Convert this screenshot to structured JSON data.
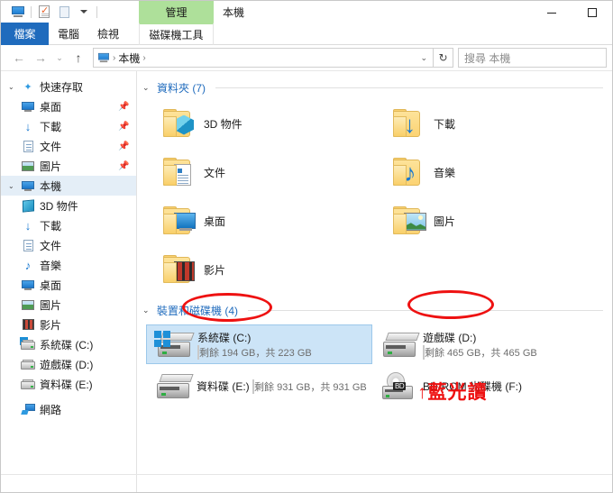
{
  "window": {
    "title": "本機",
    "manage_tab": "管理",
    "controls": {
      "minimize": "minimize-icon",
      "maximize": "maximize-icon"
    }
  },
  "quick_access_toolbar": {
    "items": [
      {
        "name": "this-pc-icon",
        "label": "本機"
      },
      {
        "name": "properties-icon",
        "label": "內容"
      },
      {
        "name": "new-folder-icon",
        "label": "新增資料夾"
      },
      {
        "name": "customize-dropdown-icon",
        "label": "自訂快速存取工具列"
      }
    ]
  },
  "ribbon": {
    "tabs": [
      {
        "label": "檔案",
        "active": false,
        "style": "file"
      },
      {
        "label": "電腦",
        "active": false,
        "style": "normal"
      },
      {
        "label": "檢視",
        "active": false,
        "style": "normal"
      },
      {
        "label": "磁碟機工具",
        "active": true,
        "style": "contextual"
      }
    ]
  },
  "address_bar": {
    "back": "←",
    "forward": "→",
    "recent": "⌄",
    "up": "↑",
    "breadcrumb": [
      "本機"
    ],
    "breadcrumb_separator": "›",
    "dropdown": "⌄",
    "refresh": "↻"
  },
  "search": {
    "placeholder": "搜尋 本機",
    "value": ""
  },
  "sidebar": {
    "groups": [
      {
        "label": "快速存取",
        "icon": "star-pin-icon",
        "expanded": true,
        "items": [
          {
            "label": "桌面",
            "icon": "desktop-icon",
            "pinned": true
          },
          {
            "label": "下載",
            "icon": "download-icon",
            "pinned": true
          },
          {
            "label": "文件",
            "icon": "documents-icon",
            "pinned": true
          },
          {
            "label": "圖片",
            "icon": "pictures-icon",
            "pinned": true
          }
        ]
      },
      {
        "label": "本機",
        "icon": "this-pc-icon",
        "expanded": true,
        "selected": true,
        "items": [
          {
            "label": "3D 物件",
            "icon": "3d-objects-icon",
            "pinned": false
          },
          {
            "label": "下載",
            "icon": "download-icon",
            "pinned": false
          },
          {
            "label": "文件",
            "icon": "documents-icon",
            "pinned": false
          },
          {
            "label": "音樂",
            "icon": "music-icon",
            "pinned": false
          },
          {
            "label": "桌面",
            "icon": "desktop-icon",
            "pinned": false
          },
          {
            "label": "圖片",
            "icon": "pictures-icon",
            "pinned": false
          },
          {
            "label": "影片",
            "icon": "videos-icon",
            "pinned": false
          },
          {
            "label": "系統碟 (C:)",
            "icon": "system-drive-icon",
            "pinned": false
          },
          {
            "label": "遊戲碟 (D:)",
            "icon": "drive-icon",
            "pinned": false
          },
          {
            "label": "資料碟 (E:)",
            "icon": "drive-icon",
            "pinned": false
          }
        ]
      },
      {
        "label": "網路",
        "icon": "network-icon",
        "expanded": false,
        "items": []
      }
    ]
  },
  "main": {
    "folders_group": {
      "title": "資料夾 (7)",
      "chevron": "⌄",
      "items": [
        {
          "label": "3D 物件",
          "icon": "folder-3d-objects-icon"
        },
        {
          "label": "下載",
          "icon": "folder-downloads-icon"
        },
        {
          "label": "文件",
          "icon": "folder-documents-icon"
        },
        {
          "label": "音樂",
          "icon": "folder-music-icon"
        },
        {
          "label": "桌面",
          "icon": "folder-desktop-icon"
        },
        {
          "label": "圖片",
          "icon": "folder-pictures-icon"
        },
        {
          "label": "影片",
          "icon": "folder-videos-icon"
        }
      ]
    },
    "devices_group": {
      "title": "裝置和磁碟機 (4)",
      "chevron": "⌄",
      "items": [
        {
          "label": "系統碟 (C:)",
          "icon": "system-drive-icon",
          "size_text": "剩餘 194 GB，共 223 GB",
          "free_gb": 194,
          "total_gb": 223,
          "used_percent": 13,
          "selected": true,
          "bar_color": "#1b86cd"
        },
        {
          "label": "遊戲碟 (D:)",
          "icon": "drive-icon",
          "size_text": "剩餘 465 GB，共 465 GB",
          "free_gb": 465,
          "total_gb": 465,
          "used_percent": 0,
          "selected": false,
          "bar_color": "#1b86cd"
        },
        {
          "label": "資料碟 (E:)",
          "icon": "drive-icon",
          "size_text": "剩餘 931 GB，共 931 GB",
          "free_gb": 931,
          "total_gb": 931,
          "used_percent": 0,
          "selected": false,
          "bar_color": "#1b86cd"
        },
        {
          "label": "BD-ROM 光碟機 (F:)",
          "icon": "bd-rom-drive-icon",
          "size_text": "",
          "selected": false
        }
      ]
    }
  },
  "annotations": {
    "color": "#ee1111",
    "ellipse_c": {
      "target": "系統碟 (C:)"
    },
    "ellipse_d": {
      "target": "遊戲碟 (D:)"
    },
    "note": "↑藍光讀"
  }
}
